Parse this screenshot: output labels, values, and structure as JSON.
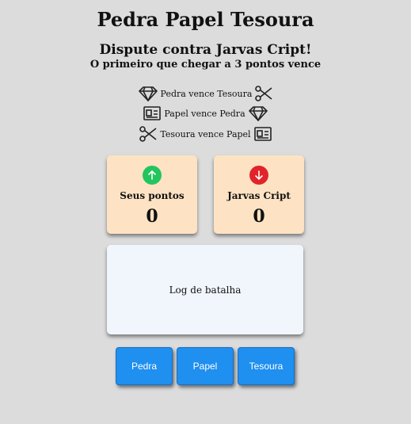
{
  "header": {
    "title": "Pedra Papel Tesoura",
    "subtitle": "Dispute contra Jarvas Cript!",
    "tagline": "O primeiro que chegar a 3 pontos vence"
  },
  "rules": [
    {
      "text": "Pedra vence Tesoura",
      "left_icon": "diamond-icon",
      "right_icon": "scissors-icon"
    },
    {
      "text": "Papel vence Pedra",
      "left_icon": "newspaper-icon",
      "right_icon": "diamond-icon"
    },
    {
      "text": "Tesoura vence Papel",
      "left_icon": "scissors-icon",
      "right_icon": "newspaper-icon"
    }
  ],
  "player": {
    "label": "Seus pontos",
    "score": "0",
    "icon": "arrow-up-icon",
    "color": "#22c55e"
  },
  "opponent": {
    "label": "Jarvas Cript",
    "score": "0",
    "icon": "arrow-down-icon",
    "color": "#e0242a"
  },
  "log": {
    "text": "Log de batalha"
  },
  "buttons": {
    "rock": "Pedra",
    "paper": "Papel",
    "scissors": "Tesoura"
  },
  "colors": {
    "background": "#dcdcdc",
    "card": "#fde3c3",
    "log_bg": "#f0f6fc",
    "button": "#1f8ff0"
  }
}
